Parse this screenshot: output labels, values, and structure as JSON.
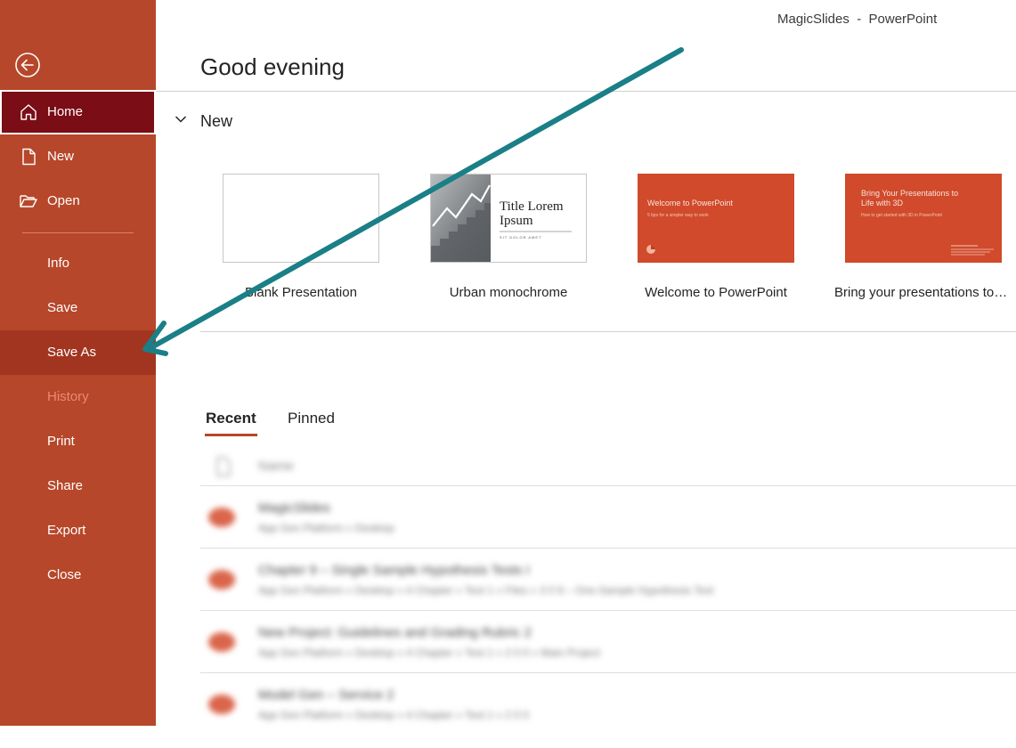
{
  "window": {
    "title": "MagicSlides  -  PowerPoint"
  },
  "sidebar": {
    "back_icon": "arrow-left-circle-icon",
    "items": [
      {
        "label": "Home",
        "icon": "home-icon",
        "state": "active"
      },
      {
        "label": "New",
        "icon": "new-file-icon",
        "state": "normal"
      },
      {
        "label": "Open",
        "icon": "open-folder-icon",
        "state": "normal"
      },
      {
        "label": "Info",
        "state": "normal"
      },
      {
        "label": "Save",
        "state": "normal"
      },
      {
        "label": "Save As",
        "state": "hover"
      },
      {
        "label": "History",
        "state": "disabled"
      },
      {
        "label": "Print",
        "state": "normal"
      },
      {
        "label": "Share",
        "state": "normal"
      },
      {
        "label": "Export",
        "state": "normal"
      },
      {
        "label": "Close",
        "state": "normal"
      }
    ]
  },
  "main": {
    "greeting": "Good evening",
    "new_section": {
      "label": "New",
      "templates": [
        {
          "label": "Blank Presentation"
        },
        {
          "label": "Urban monochrome",
          "thumb_title": "Title Lorem Ipsum",
          "thumb_subtitle": "SIT DOLOR AMET"
        },
        {
          "label": "Welcome to PowerPoint",
          "thumb_title": "Welcome to PowerPoint",
          "thumb_subtitle": "5 tips for a simpler way to work"
        },
        {
          "label": "Bring your presentations to…",
          "thumb_title": "Bring Your Presentations to Life with 3D",
          "thumb_subtitle": "How to get started with 3D in PowerPoint"
        }
      ]
    },
    "tabs": [
      {
        "label": "Recent",
        "selected": true
      },
      {
        "label": "Pinned",
        "selected": false
      }
    ],
    "recent_header": "Name",
    "recent_files": [
      {
        "name": "MagicSlides",
        "path": "App Gen Platform » Desktop"
      },
      {
        "name": "Chapter 9 – Single Sample Hypothesis Tests I",
        "path": "App Gen Platform » Desktop » 4 Chapter » Test 1 » Files » 3 0 9 – One-Sample Hypothesis Test"
      },
      {
        "name": "New Project: Guidelines and Grading Rubric 2",
        "path": "App Gen Platform » Desktop » 4 Chapter » Test 1 » 2 0 0 » Main Project"
      },
      {
        "name": "Model Gen – Service 2",
        "path": "App Gen Platform » Desktop » 4 Chapter » Test 1 » 2 0 0"
      }
    ]
  },
  "colors": {
    "sidebar": "#b7472a",
    "active": "#7a0d16",
    "accent": "#b7472a",
    "annotation_arrow": "#1a7f86"
  }
}
